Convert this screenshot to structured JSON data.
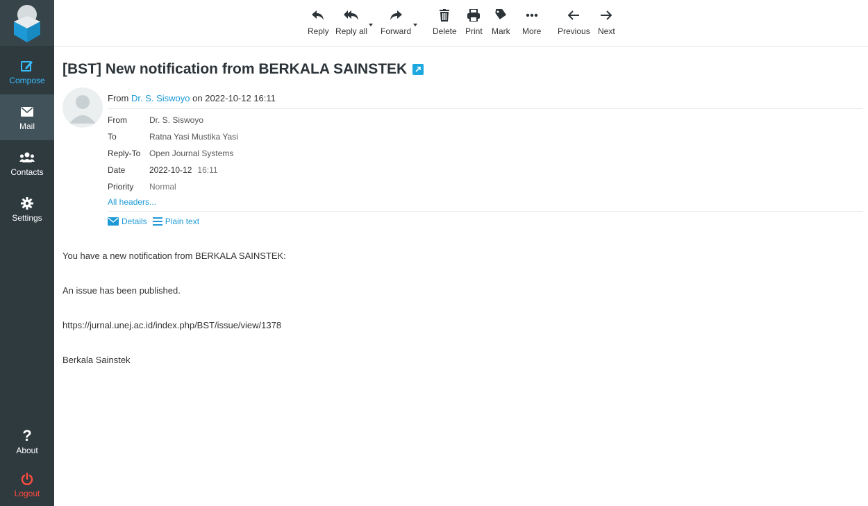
{
  "sidebar": {
    "items": [
      {
        "label": "Compose"
      },
      {
        "label": "Mail"
      },
      {
        "label": "Contacts"
      },
      {
        "label": "Settings"
      },
      {
        "label": "About"
      },
      {
        "label": "Logout"
      }
    ]
  },
  "toolbar": {
    "reply": "Reply",
    "reply_all": "Reply all",
    "forward": "Forward",
    "delete": "Delete",
    "print": "Print",
    "mark": "Mark",
    "more": "More",
    "previous": "Previous",
    "next": "Next"
  },
  "message": {
    "subject": "[BST] New notification from BERKALA SAINSTEK",
    "summary_from_prefix": "From",
    "summary_sender": "Dr. S. Siswoyo",
    "summary_on": "on",
    "summary_date": "2022-10-12 16:11",
    "headers": {
      "from_label": "From",
      "from_value": "Dr. S. Siswoyo",
      "to_label": "To",
      "to_value": "Ratna Yasi Mustika Yasi",
      "replyto_label": "Reply-To",
      "replyto_value": "Open Journal Systems",
      "date_label": "Date",
      "date_value": "2022-10-12",
      "time_value": "16:11",
      "priority_label": "Priority",
      "priority_value": "Normal"
    },
    "all_headers": "All headers...",
    "details_label": "Details",
    "plain_text_label": "Plain text",
    "body": {
      "line1": "You have a new notification from BERKALA SAINSTEK:",
      "line2": "An issue has been published.",
      "line3": "https://jurnal.unej.ac.id/index.php/BST/issue/view/1378",
      "line4": "Berkala Sainstek"
    }
  },
  "colors": {
    "sidebar_bg": "#2f3a3f",
    "accent": "#1d9ad6",
    "compose_blue": "#37beff",
    "logout_red": "#ff4b3e"
  }
}
